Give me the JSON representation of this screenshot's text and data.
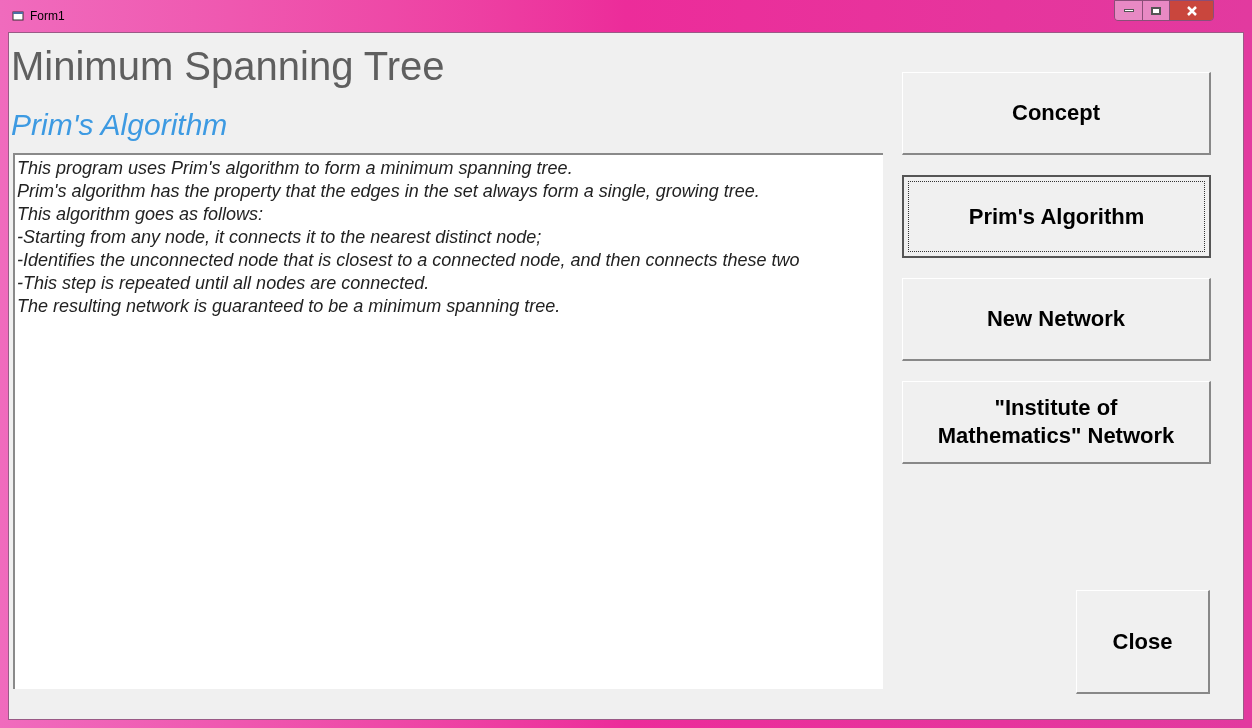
{
  "window": {
    "title": "Form1"
  },
  "heading": "Minimum Spanning Tree",
  "subheading": "Prim's Algorithm",
  "description_lines": [
    "This program uses Prim's algorithm to form a minimum spanning tree.",
    "Prim's algorithm has the property that the edges in the set always form a single, growing tree.",
    "This algorithm goes as follows:",
    "-Starting from any node, it connects it to the nearest distinct node;",
    "-Identifies the unconnected node that is closest to a connected node, and then connects these two",
    "-This step is repeated until all nodes are connected.",
    "The resulting network is guaranteed to be a minimum spanning tree."
  ],
  "buttons": [
    {
      "label": "Concept",
      "focused": false
    },
    {
      "label": "Prim's Algorithm",
      "focused": true
    },
    {
      "label": "New Network",
      "focused": false
    },
    {
      "label": "\"Institute of Mathematics\" Network",
      "focused": false
    }
  ],
  "close_button": {
    "label": "Close"
  }
}
